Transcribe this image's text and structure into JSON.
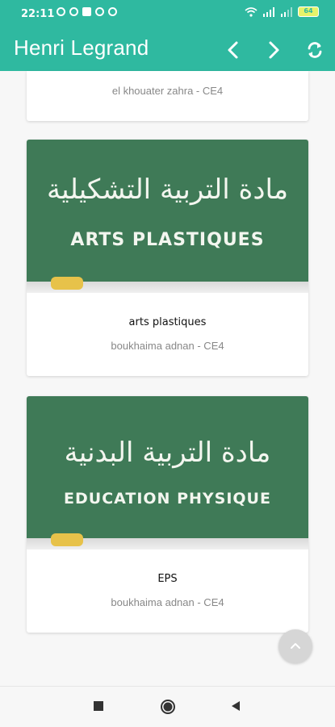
{
  "status_bar": {
    "time": "22:11",
    "battery": "64"
  },
  "app_bar": {
    "title": "Henri Legrand",
    "icons": [
      "chevron-left-icon",
      "chevron-right-icon",
      "refresh-icon"
    ]
  },
  "cards": [
    {
      "subtitle": "el khouater zahra - CE4"
    },
    {
      "image_arabic": "مادة التربية التشكيلية",
      "image_latin": "ARTS PLASTIQUES",
      "title": "arts plastiques",
      "subtitle": "boukhaima adnan - CE4"
    },
    {
      "image_arabic": "مادة التربية البدنية",
      "image_latin": "EDUCATION PHYSIQUE",
      "title": "EPS",
      "subtitle": "boukhaima adnan - CE4"
    }
  ],
  "fab": {
    "icon": "chevron-up-icon"
  },
  "nav_bar": {
    "icons": [
      "recents-square-icon",
      "home-circle-icon",
      "back-triangle-icon"
    ]
  },
  "colors": {
    "accent": "#2fb9a0",
    "chalkboard": "#3f7a57"
  }
}
